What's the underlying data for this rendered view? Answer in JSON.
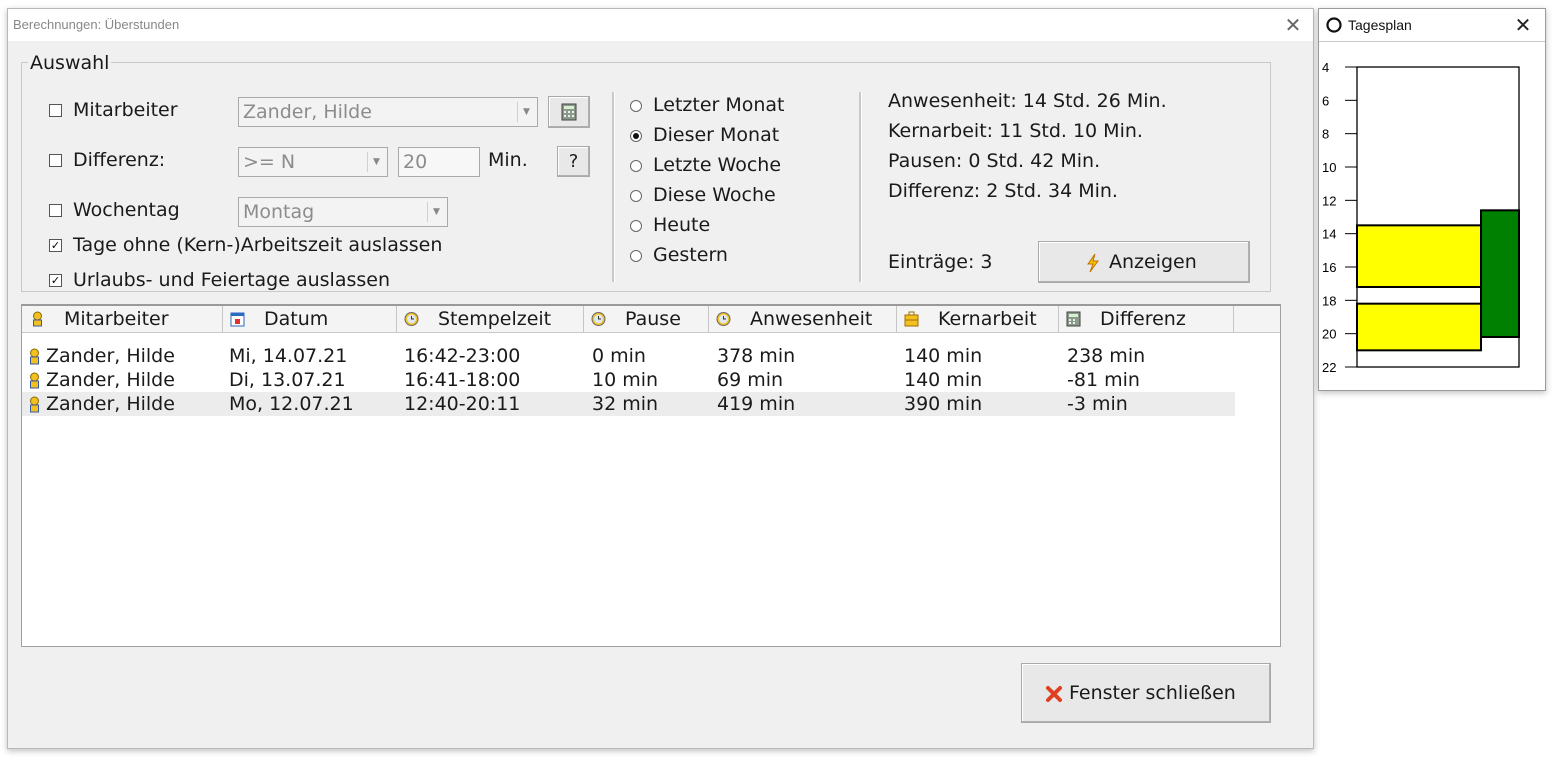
{
  "window": {
    "title": "Berechnungen: Überstunden",
    "close_glyph": "✕"
  },
  "filters": {
    "group_label": "Auswahl",
    "mitarbeiter": {
      "label": "Mitarbeiter",
      "checked": false,
      "value": "Zander, Hilde"
    },
    "differenz": {
      "label": "Differenz:",
      "checked": false,
      "operator": ">= N",
      "value": "20",
      "unit": "Min.",
      "help_label": "?"
    },
    "wochentag": {
      "label": "Wochentag",
      "checked": false,
      "value": "Montag"
    },
    "skip_no_work": {
      "label": "Tage ohne (Kern-)Arbeitszeit auslassen",
      "checked": true,
      "mark": "✓"
    },
    "skip_holidays": {
      "label": "Urlaubs- und Feiertage auslassen",
      "checked": true,
      "mark": "✓"
    }
  },
  "periods": [
    {
      "label": "Letzter Monat",
      "selected": false
    },
    {
      "label": "Dieser Monat",
      "selected": true
    },
    {
      "label": "Letzte Woche",
      "selected": false
    },
    {
      "label": "Diese Woche",
      "selected": false
    },
    {
      "label": "Heute",
      "selected": false
    },
    {
      "label": "Gestern",
      "selected": false
    }
  ],
  "summary": {
    "anwesenheit": "Anwesenheit: 14 Std. 26 Min.",
    "kernarbeit": "Kernarbeit: 11 Std. 10 Min.",
    "pausen": "Pausen: 0 Std. 42 Min.",
    "differenz": "Differenz: 2 Std. 34 Min.",
    "eintraege": "Einträge: 3",
    "show_button": "Anzeigen"
  },
  "table": {
    "columns": [
      "Mitarbeiter",
      "Datum",
      "Stempelzeit",
      "Pause",
      "Anwesenheit",
      "Kernarbeit",
      "Differenz"
    ],
    "rows": [
      [
        "Zander, Hilde",
        "Mi, 14.07.21",
        "16:42-23:00",
        "0 min",
        "378 min",
        "140 min",
        "238 min"
      ],
      [
        "Zander, Hilde",
        "Di, 13.07.21",
        "16:41-18:00",
        "10 min",
        "69 min",
        "140 min",
        "-81 min"
      ],
      [
        "Zander, Hilde",
        "Mo, 12.07.21",
        "12:40-20:11",
        "32 min",
        "419 min",
        "390 min",
        "-3 min"
      ]
    ]
  },
  "close_button": {
    "label": "Fenster schließen"
  },
  "tagesplan": {
    "title": "Tagesplan",
    "close_glyph": "✕",
    "hour_ticks": [
      "4",
      "6",
      "8",
      "10",
      "12",
      "14",
      "16",
      "18",
      "20",
      "22"
    ],
    "hour_range": [
      4,
      22
    ],
    "blocks": [
      {
        "start": 13.5,
        "end": 17.2,
        "lane": "left",
        "color": "#ffff00"
      },
      {
        "start": 18.2,
        "end": 21.0,
        "lane": "left",
        "color": "#ffff00"
      },
      {
        "start": 12.6,
        "end": 20.2,
        "lane": "right",
        "color": "#008000"
      }
    ]
  },
  "colors": {
    "accent_yellow": "#ffff00",
    "accent_green": "#008000",
    "close_icon_red": "#e04020",
    "lightning": "#f0a000"
  }
}
